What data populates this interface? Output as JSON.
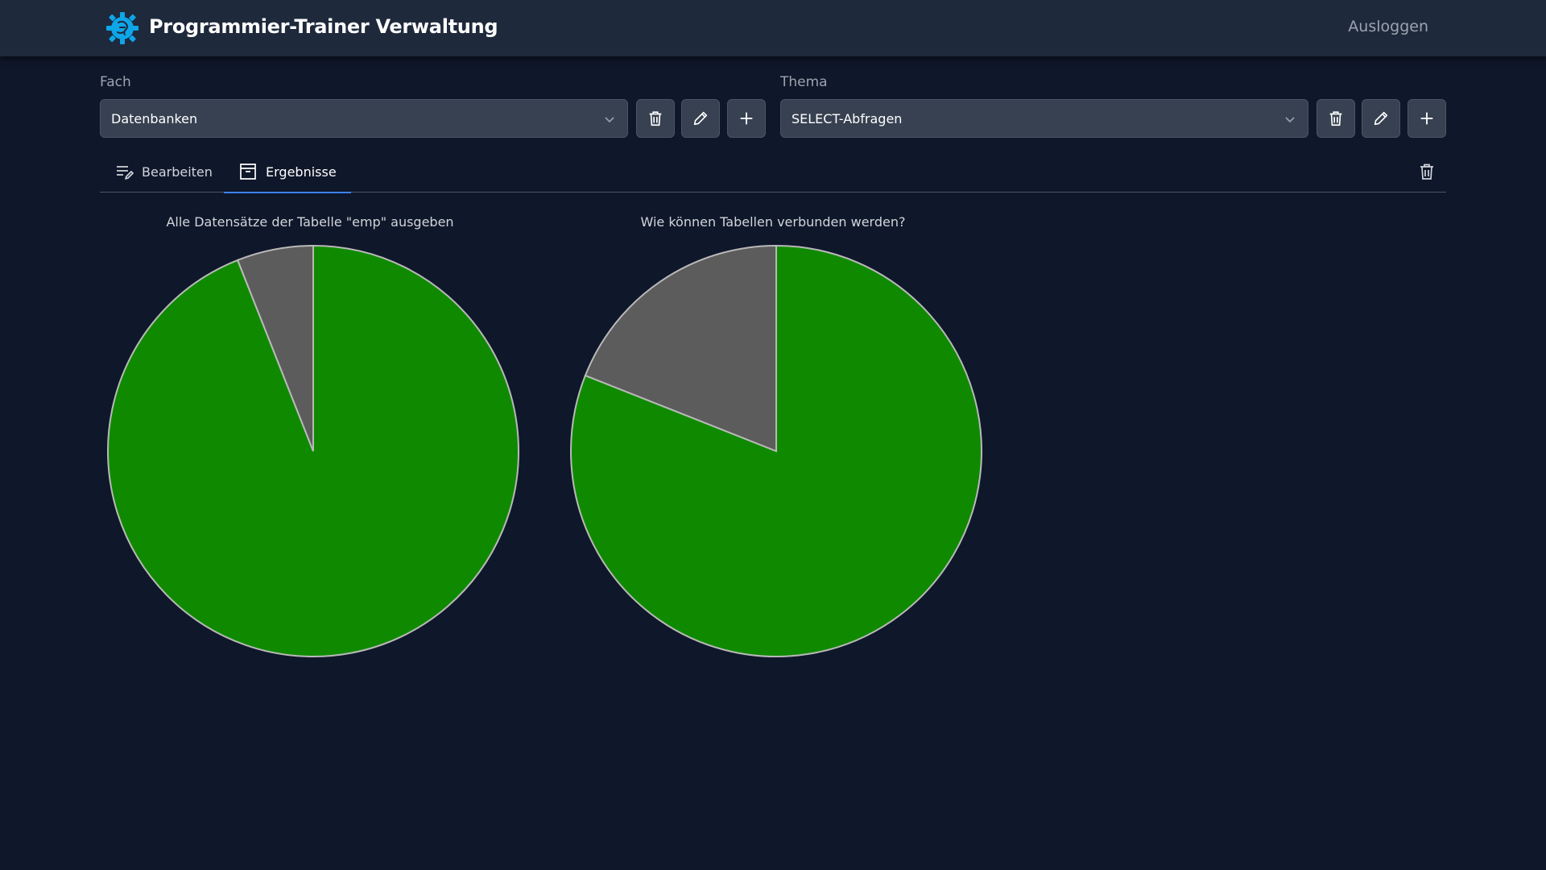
{
  "header": {
    "title": "Programmier-Trainer Verwaltung",
    "logout_label": "Ausloggen",
    "logo_icon": "gear-brain-icon",
    "accent_color": "#0ea5e9"
  },
  "filters": {
    "subject": {
      "label": "Fach",
      "selected": "Datenbanken"
    },
    "topic": {
      "label": "Thema",
      "selected": "SELECT-Abfragen"
    }
  },
  "tabs": [
    {
      "label": "Bearbeiten",
      "icon": "edit-list-icon",
      "active": false
    },
    {
      "label": "Ergebnisse",
      "icon": "archive-box-icon",
      "active": true
    }
  ],
  "colors": {
    "correct": "#0f8a00",
    "incorrect": "#5c5c5c",
    "slice_border": "#b9b9b9"
  },
  "chart_data": [
    {
      "type": "pie",
      "title": "Alle Datensätze der Tabelle \"emp\" ausgeben",
      "slices": [
        {
          "value": 0.94,
          "color": "#0f8a00"
        },
        {
          "value": 0.06,
          "color": "#5c5c5c"
        }
      ]
    },
    {
      "type": "pie",
      "title": "Wie können Tabellen verbunden werden?",
      "slices": [
        {
          "value": 0.81,
          "color": "#0f8a00"
        },
        {
          "value": 0.19,
          "color": "#5c5c5c"
        }
      ]
    }
  ]
}
